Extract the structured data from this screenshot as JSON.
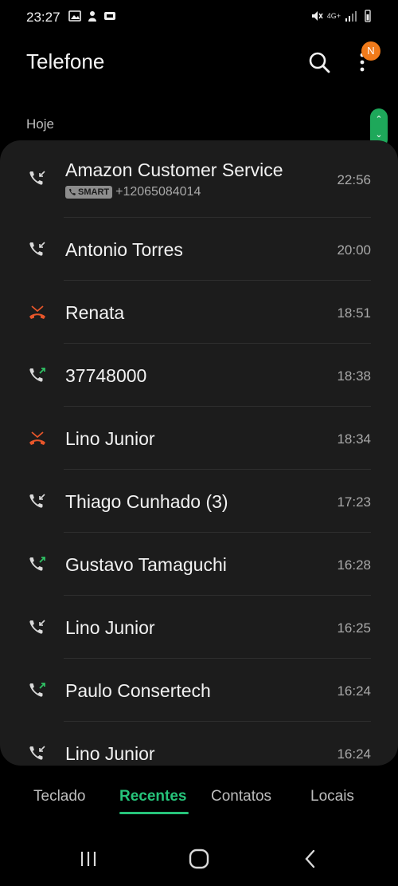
{
  "status_bar": {
    "time": "23:27",
    "network_label": "4G+"
  },
  "header": {
    "title": "Telefone",
    "notification_badge": "N"
  },
  "section": {
    "label": "Hoje"
  },
  "calls": [
    {
      "name": "Amazon Customer Service",
      "time": "22:56",
      "type": "incoming",
      "badge": "SMART",
      "number": "+12065084014"
    },
    {
      "name": "Antonio Torres",
      "time": "20:00",
      "type": "incoming"
    },
    {
      "name": "Renata",
      "time": "18:51",
      "type": "missed"
    },
    {
      "name": "37748000",
      "time": "18:38",
      "type": "outgoing"
    },
    {
      "name": "Lino Junior",
      "time": "18:34",
      "type": "missed"
    },
    {
      "name": "Thiago Cunhado (3)",
      "time": "17:23",
      "type": "incoming"
    },
    {
      "name": "Gustavo Tamaguchi",
      "time": "16:28",
      "type": "outgoing"
    },
    {
      "name": "Lino Junior",
      "time": "16:25",
      "type": "incoming"
    },
    {
      "name": "Paulo Consertech",
      "time": "16:24",
      "type": "outgoing"
    },
    {
      "name": "Lino Junior",
      "time": "16:24",
      "type": "incoming"
    }
  ],
  "tabs": [
    {
      "label": "Teclado"
    },
    {
      "label": "Recentes",
      "active": true
    },
    {
      "label": "Contatos"
    },
    {
      "label": "Locais"
    }
  ],
  "colors": {
    "accent": "#26c37a",
    "missed": "#e8562a",
    "outgoing": "#2fbf63",
    "badge": "#f07a1a"
  },
  "icons": {
    "incoming": "incoming-call-icon",
    "outgoing": "outgoing-call-icon",
    "missed": "missed-call-icon",
    "search": "search-icon",
    "more": "more-options-icon"
  }
}
